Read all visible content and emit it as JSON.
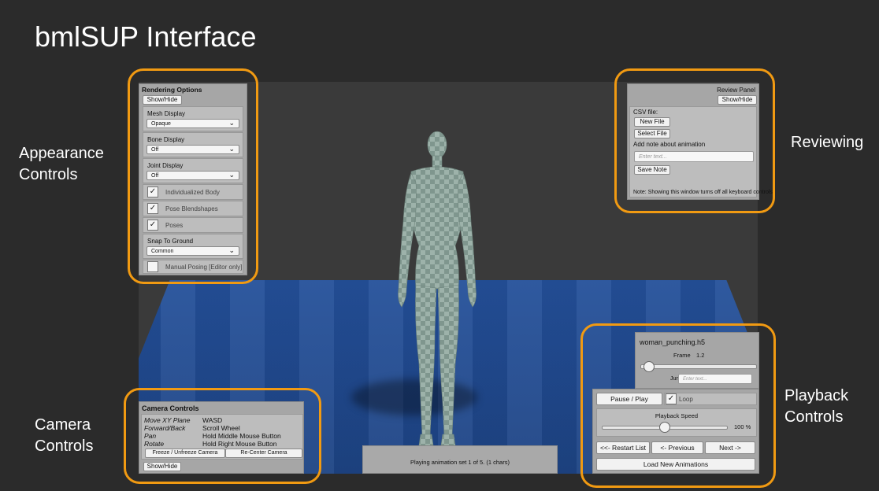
{
  "slide": {
    "title": "bmlSUP Interface",
    "labels": {
      "appearance": [
        "Appearance",
        "Controls"
      ],
      "camera": [
        "Camera",
        "Controls"
      ],
      "reviewing": "Reviewing",
      "playback": [
        "Playback",
        "Controls"
      ]
    }
  },
  "rendering": {
    "title": "Rendering Options",
    "show_hide": "Show/Hide",
    "mesh_label": "Mesh Display",
    "mesh_value": "Opaque",
    "bone_label": "Bone Display",
    "bone_value": "Off",
    "joint_label": "Joint Display",
    "joint_value": "Off",
    "individualized": "Individualized Body",
    "pose_blendshapes": "Pose Blendshapes",
    "poses": "Poses",
    "snap_label": "Snap To Ground",
    "snap_value": "Common",
    "manual_posing": "Manual Posing [Editor only]",
    "check_mark": "✓"
  },
  "review": {
    "title": "Review Panel",
    "show_hide": "Show/Hide",
    "csv_label": "CSV file:",
    "new_file": "New File",
    "select_file": "Select File",
    "note_label": "Add note about animation",
    "note_placeholder": "Enter text...",
    "save_note": "Save Note",
    "footer": "Note: Showing this window turns off all keyboard controls"
  },
  "camera": {
    "title": "Camera Controls",
    "rows": [
      {
        "action": "Move XY Plane",
        "key": "WASD"
      },
      {
        "action": "Forward/Back",
        "key": "Scroll Wheel"
      },
      {
        "action": "Pan",
        "key": "Hold Middle Mouse Button"
      },
      {
        "action": "Rotate",
        "key": "Hold Right Mouse Button"
      }
    ],
    "freeze": "Freeze / Unfreeze Camera",
    "recenter": "Re-Center Camera",
    "show_hide": "Show/Hide"
  },
  "status": {
    "text": "Playing animation set 1 of 5. (1 chars)"
  },
  "playback": {
    "filename": "woman_punching.h5",
    "frame_label": "Frame",
    "frame_value": "1.2",
    "frame_fraction": 0.02,
    "jump_label": "Jump To:",
    "jump_placeholder": "Enter text...",
    "pause_play": "Pause / Play",
    "loop": "Loop",
    "speed_label": "Playback Speed",
    "speed_value": "100 %",
    "speed_fraction": 0.5,
    "restart": "<<- Restart List",
    "previous": "<- Previous",
    "next": "Next ->",
    "load_new": "Load New Animations"
  },
  "colors": {
    "highlight": "#f19a12",
    "floor": "#24509a",
    "background": "#2b2b2b"
  }
}
